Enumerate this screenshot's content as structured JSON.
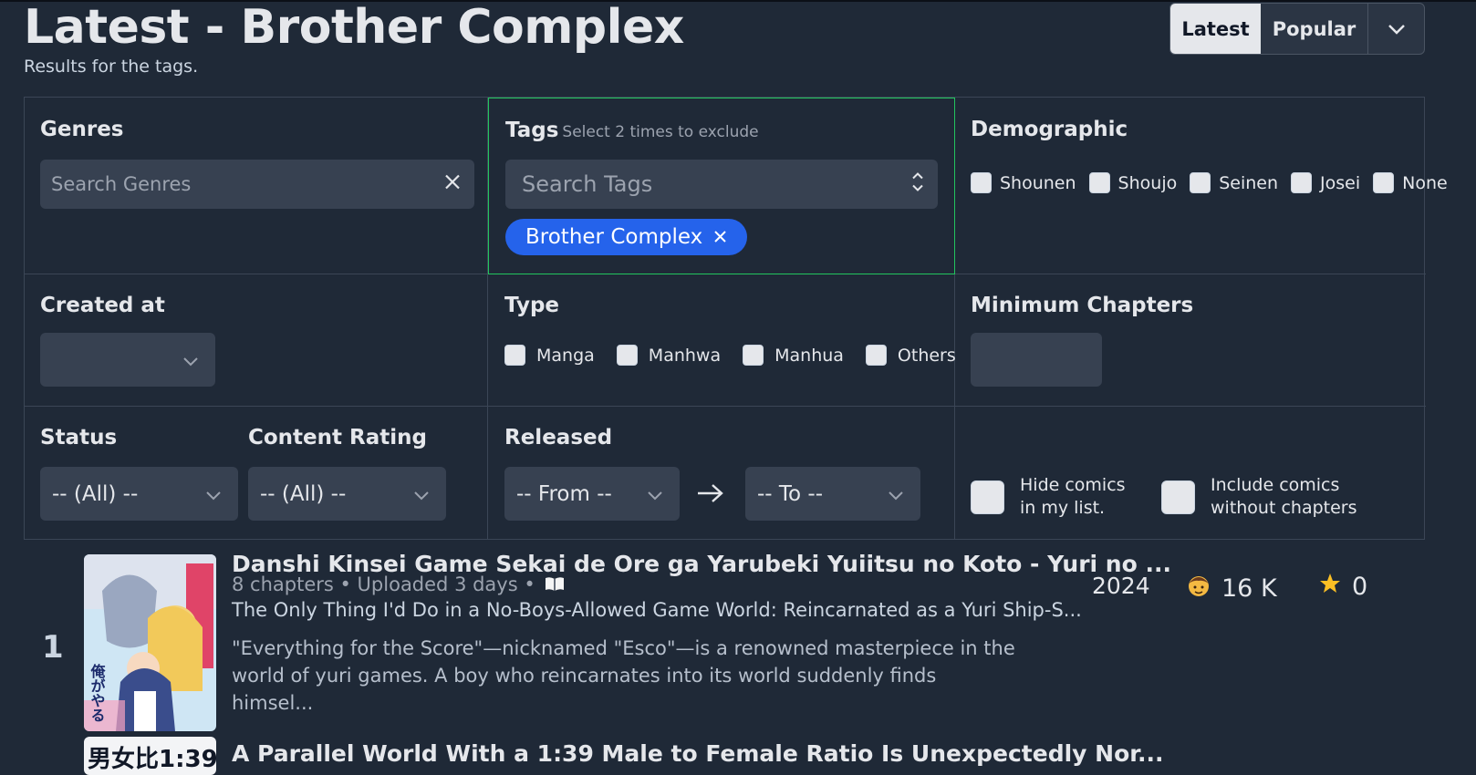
{
  "header": {
    "title": "Latest - Brother Complex",
    "subtitle": "Results for the tags."
  },
  "sort": {
    "latest_label": "Latest",
    "popular_label": "Popular",
    "active": "Latest"
  },
  "filters": {
    "genres": {
      "title": "Genres",
      "placeholder": "Search Genres"
    },
    "tags": {
      "title": "Tags",
      "hint": "Select 2 times to exclude",
      "placeholder": "Search Tags",
      "selected": [
        {
          "label": "Brother Complex"
        }
      ]
    },
    "demographic": {
      "title": "Demographic",
      "options": [
        "Shounen",
        "Shoujo",
        "Seinen",
        "Josei",
        "None"
      ]
    },
    "created_at": {
      "title": "Created at",
      "value": ""
    },
    "type": {
      "title": "Type",
      "options": [
        "Manga",
        "Manhwa",
        "Manhua",
        "Others"
      ]
    },
    "min_chapters": {
      "title": "Minimum Chapters",
      "value": ""
    },
    "status": {
      "title": "Status",
      "value": "-- (All) --"
    },
    "content_rating": {
      "title": "Content Rating",
      "value": "-- (All) --"
    },
    "released": {
      "title": "Released",
      "from": "-- From --",
      "to": "-- To --"
    },
    "extra": {
      "hide_in_list": "Hide comics in my list.",
      "include_without_chapters": "Include comics without chapters"
    }
  },
  "results": [
    {
      "rank": "1",
      "title": "Danshi Kinsei Game Sekai de Ore ga Yarubeki Yuiitsu no Koto - Yuri no ...",
      "meta": "8 chapters • Uploaded 3 days •",
      "alt_title": "The Only Thing I'd Do in a No-Boys-Allowed Game World: Reincarnated as a Yuri Ship-S...",
      "description": "\"Everything for the Score\"—nicknamed \"Esco\"—is a renowned masterpiece in the world of yuri games. A boy who reincarnates into its world suddenly finds himsel...",
      "year": "2024",
      "follows": "16 K",
      "rating": "0"
    },
    {
      "rank": "",
      "title": "A Parallel World With a 1:39 Male to Female Ratio Is Unexpectedly Nor...",
      "cover_text": "男女比1:39"
    }
  ],
  "icons": {
    "follows_icon": "person-icon",
    "rating_icon": "star-icon",
    "book_icon": "book-icon"
  }
}
